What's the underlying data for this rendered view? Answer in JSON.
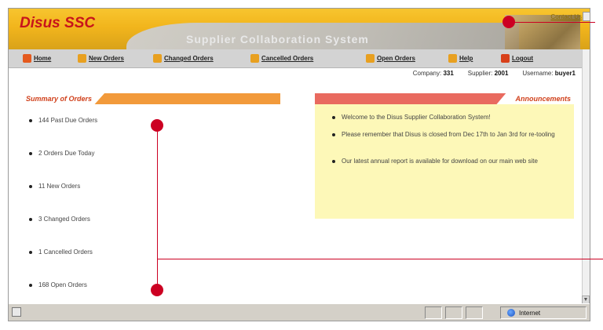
{
  "header": {
    "brand": "Disus SSC",
    "system_name": "Supplier Collaboration System",
    "contact_link": "Contact Us"
  },
  "nav": {
    "items": [
      {
        "label": "Home",
        "icon": "home-icon"
      },
      {
        "label": "New Orders",
        "icon": "new-orders-icon"
      },
      {
        "label": "Changed Orders",
        "icon": "changed-orders-icon"
      },
      {
        "label": "Cancelled Orders",
        "icon": "cancelled-orders-icon"
      },
      {
        "label": "Open Orders",
        "icon": "open-orders-icon"
      },
      {
        "label": "Help",
        "icon": "help-icon"
      },
      {
        "label": "Logout",
        "icon": "logout-icon"
      }
    ]
  },
  "user_info": {
    "company_label": "Company:",
    "company_value": "331",
    "supplier_label": "Supplier:",
    "supplier_value": "2001",
    "username_label": "Username:",
    "username_value": "buyer1"
  },
  "summary": {
    "title": "Summary of Orders",
    "items": [
      "144 Past Due Orders",
      "2 Orders Due Today",
      "11 New Orders",
      "3 Changed Orders",
      "1 Cancelled Orders",
      "168 Open Orders"
    ]
  },
  "announcements": {
    "title": "Announcements",
    "items": [
      "Welcome to the Disus Supplier Collaboration System!",
      "Please remember that Disus is closed from Dec 17th to Jan 3rd for re-tooling",
      "Our latest annual report is available for download on our main web site"
    ]
  },
  "statusbar": {
    "zone": "Internet"
  },
  "colors": {
    "brand_red": "#c8141b",
    "banner_yellow": "#f2b51c",
    "summary_orange": "#f29a3b",
    "announce_salmon": "#e96a5f",
    "announce_bg": "#fdf8b8",
    "callout_red": "#cc0022"
  }
}
